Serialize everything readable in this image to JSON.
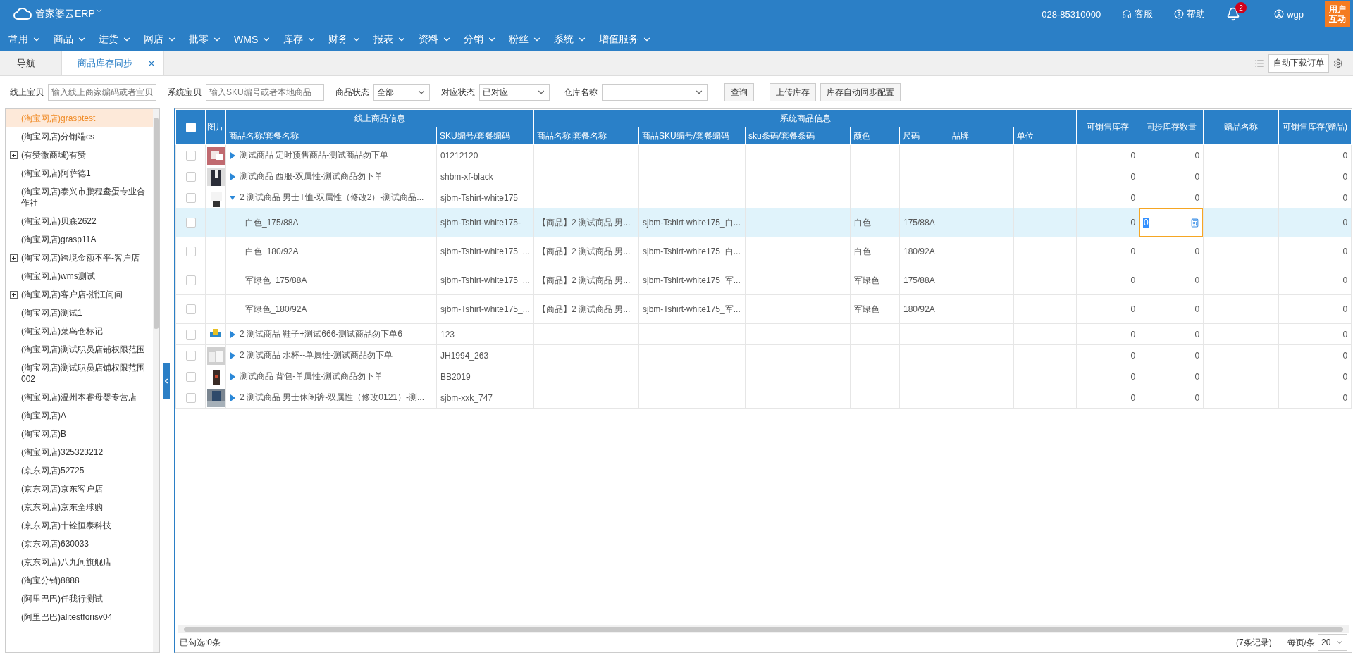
{
  "topbar": {
    "logo": "管家婆云ERP",
    "phone": "028-85310000",
    "service": "客服",
    "help": "帮助",
    "notifications": "2",
    "user": "wgp",
    "feedback": "用户互动"
  },
  "menu": [
    "常用",
    "商品",
    "进货",
    "网店",
    "批零",
    "WMS",
    "库存",
    "财务",
    "报表",
    "资料",
    "分销",
    "粉丝",
    "系统",
    "增值服务"
  ],
  "tabs": [
    {
      "label": "导航",
      "selected": false,
      "closable": false
    },
    {
      "label": "商品库存同步",
      "selected": true,
      "closable": true
    }
  ],
  "tab_actions": {
    "auto_download": "自动下载订单"
  },
  "filters": {
    "online_label": "线上宝贝",
    "online_placeholder": "输入线上商家编码或者宝贝",
    "system_label": "系统宝贝",
    "system_placeholder": "输入SKU编号或者本地商品",
    "status_label": "商品状态",
    "status_value": "全部",
    "match_label": "对应状态",
    "match_value": "已对应",
    "warehouse_label": "仓库名称",
    "buttons": [
      "查询",
      "上传库存",
      "库存自动同步配置"
    ]
  },
  "sidebar": {
    "items": [
      {
        "label": "(淘宝网店)grasptest",
        "kind": "shop",
        "selected": true
      },
      {
        "label": "(淘宝网店)分销端cs",
        "kind": "shop",
        "selected": false
      },
      {
        "label": "(有赞微商城)有赞",
        "kind": "group",
        "selected": false
      },
      {
        "label": "(淘宝网店)阿萨德1",
        "kind": "shop",
        "selected": false
      },
      {
        "label": "(淘宝网店)泰兴市鹏程鸯蛋专业合作社",
        "kind": "shop",
        "selected": false
      },
      {
        "label": "(淘宝网店)贝森2622",
        "kind": "shop",
        "selected": false
      },
      {
        "label": "(淘宝网店)grasp11A",
        "kind": "shop",
        "selected": false
      },
      {
        "label": "(淘宝网店)跨境金额不平-客户店",
        "kind": "group",
        "selected": false
      },
      {
        "label": "(淘宝网店)wms测试",
        "kind": "shop",
        "selected": false
      },
      {
        "label": "(淘宝网店)客户店-浙江问问",
        "kind": "group",
        "selected": false
      },
      {
        "label": "(淘宝网店)测试1",
        "kind": "shop",
        "selected": false
      },
      {
        "label": "(淘宝网店)菜鸟仓标记",
        "kind": "shop",
        "selected": false
      },
      {
        "label": "(淘宝网店)测试职员店铺权限范围",
        "kind": "shop",
        "selected": false
      },
      {
        "label": "(淘宝网店)测试职员店铺权限范围002",
        "kind": "shop",
        "selected": false
      },
      {
        "label": "(淘宝网店)温州本睿母婴专营店",
        "kind": "shop",
        "selected": false
      },
      {
        "label": "(淘宝网店)A",
        "kind": "shop",
        "selected": false
      },
      {
        "label": "(淘宝网店)B",
        "kind": "shop",
        "selected": false
      },
      {
        "label": "(淘宝网店)325323212",
        "kind": "shop",
        "selected": false
      },
      {
        "label": "(京东网店)52725",
        "kind": "shop",
        "selected": false
      },
      {
        "label": "(京东网店)京东客户店",
        "kind": "shop",
        "selected": false
      },
      {
        "label": "(京东网店)京东全球购",
        "kind": "shop",
        "selected": false
      },
      {
        "label": "(京东网店)十铨恒泰科技",
        "kind": "shop",
        "selected": false
      },
      {
        "label": "(京东网店)630033",
        "kind": "shop",
        "selected": false
      },
      {
        "label": "(京东网店)八九间旗舰店",
        "kind": "shop",
        "selected": false
      },
      {
        "label": "(淘宝分销)8888",
        "kind": "shop",
        "selected": false
      },
      {
        "label": "(阿里巴巴)任我行测试",
        "kind": "shop",
        "selected": false
      },
      {
        "label": "(阿里巴巴)alitestforisv04",
        "kind": "shop",
        "selected": false
      }
    ]
  },
  "table": {
    "select_all": {
      "checked": false
    },
    "header": [
      {
        "kind": "single",
        "label": "图片"
      },
      {
        "kind": "group",
        "label": "线上商品信息",
        "columns": [
          "商品名称/套餐名称",
          "SKU编号/套餐编码"
        ]
      },
      {
        "kind": "group",
        "label": "系统商品信息",
        "columns": [
          "商品名称|套餐名称",
          "商品SKU编号/套餐编码",
          "sku条码/套餐条码",
          "颜色",
          "尺码",
          "品牌",
          "单位"
        ]
      },
      {
        "kind": "single",
        "label": "可销售库存"
      },
      {
        "kind": "single",
        "label": "同步库存数量"
      },
      {
        "kind": "single",
        "label": "赠品名称"
      },
      {
        "kind": "single",
        "label": "可销售库存(赠品)"
      }
    ],
    "rows": [
      {
        "kind": "product",
        "checked": false,
        "selected": false,
        "expanded": false,
        "name": "测试商品 定时预售商品-测试商品勿下单",
        "sku": "01212120",
        "sellable": "0",
        "sync": "0",
        "gift_sellable": "0"
      },
      {
        "kind": "product",
        "checked": false,
        "selected": false,
        "expanded": false,
        "name": "测试商品 西服-双属性-测试商品勿下单",
        "sku": "shbm-xf-black",
        "sellable": "0",
        "sync": "0",
        "gift_sellable": "0"
      },
      {
        "kind": "product",
        "checked": false,
        "selected": false,
        "expanded": true,
        "name": "2 测试商品 男士T恤-双属性（修改2）-测试商品...",
        "sku": "sjbm-Tshirt-white175",
        "sellable": "0",
        "sync": "0",
        "gift_sellable": "0"
      },
      {
        "kind": "variant",
        "checked": false,
        "selected": true,
        "name": "白色_175/88A",
        "sku": "sjbm-Tshirt-white175-",
        "sys_name": "【商品】2 测试商品 男...",
        "sys_sku": "sjbm-Tshirt-white175_白...",
        "colour_name": "白色",
        "size": "175/88A",
        "sellable": "0",
        "sync": "0",
        "gift_sellable": "0"
      },
      {
        "kind": "variant",
        "checked": false,
        "selected": false,
        "name": "白色_180/92A",
        "sku": "sjbm-Tshirt-white175_...",
        "sys_name": "【商品】2 测试商品 男...",
        "sys_sku": "sjbm-Tshirt-white175_白...",
        "colour_name": "白色",
        "size": "180/92A",
        "sellable": "0",
        "sync": "0",
        "gift_sellable": "0"
      },
      {
        "kind": "variant",
        "checked": false,
        "selected": false,
        "name": "军绿色_175/88A",
        "sku": "sjbm-Tshirt-white175_...",
        "sys_name": "【商品】2 测试商品 男...",
        "sys_sku": "sjbm-Tshirt-white175_军...",
        "colour_name": "军绿色",
        "size": "175/88A",
        "sellable": "0",
        "sync": "0",
        "gift_sellable": "0"
      },
      {
        "kind": "variant",
        "checked": false,
        "selected": false,
        "name": "军绿色_180/92A",
        "sku": "sjbm-Tshirt-white175_...",
        "sys_name": "【商品】2 测试商品 男...",
        "sys_sku": "sjbm-Tshirt-white175_军...",
        "colour_name": "军绿色",
        "size": "180/92A",
        "sellable": "0",
        "sync": "0",
        "gift_sellable": "0"
      },
      {
        "kind": "product",
        "checked": false,
        "selected": false,
        "expanded": false,
        "name": "2 测试商品 鞋子+测试666-测试商品勿下单6",
        "sku": "123",
        "sellable": "0",
        "sync": "0",
        "gift_sellable": "0"
      },
      {
        "kind": "product",
        "checked": false,
        "selected": false,
        "expanded": false,
        "name": "2 测试商品 水杯--单属性-测试商品勿下单",
        "sku": "JH1994_263",
        "sellable": "0",
        "sync": "0",
        "gift_sellable": "0"
      },
      {
        "kind": "product",
        "checked": false,
        "selected": false,
        "expanded": false,
        "name": "测试商品 背包-单属性-测试商品勿下单",
        "sku": "BB2019",
        "sellable": "0",
        "sync": "0",
        "gift_sellable": "0"
      },
      {
        "kind": "product",
        "checked": false,
        "selected": false,
        "expanded": false,
        "name": "2 测试商品 男士休闲裤-双属性（修改0121）-测...",
        "sku": "sjbm-xxk_747",
        "sellable": "0",
        "sync": "0",
        "gift_sellable": "0"
      }
    ]
  },
  "footer": {
    "selected_count": "已勾选:0条",
    "records": "(7条记录)",
    "per_page_label": "每页/条",
    "per_page": "20"
  }
}
